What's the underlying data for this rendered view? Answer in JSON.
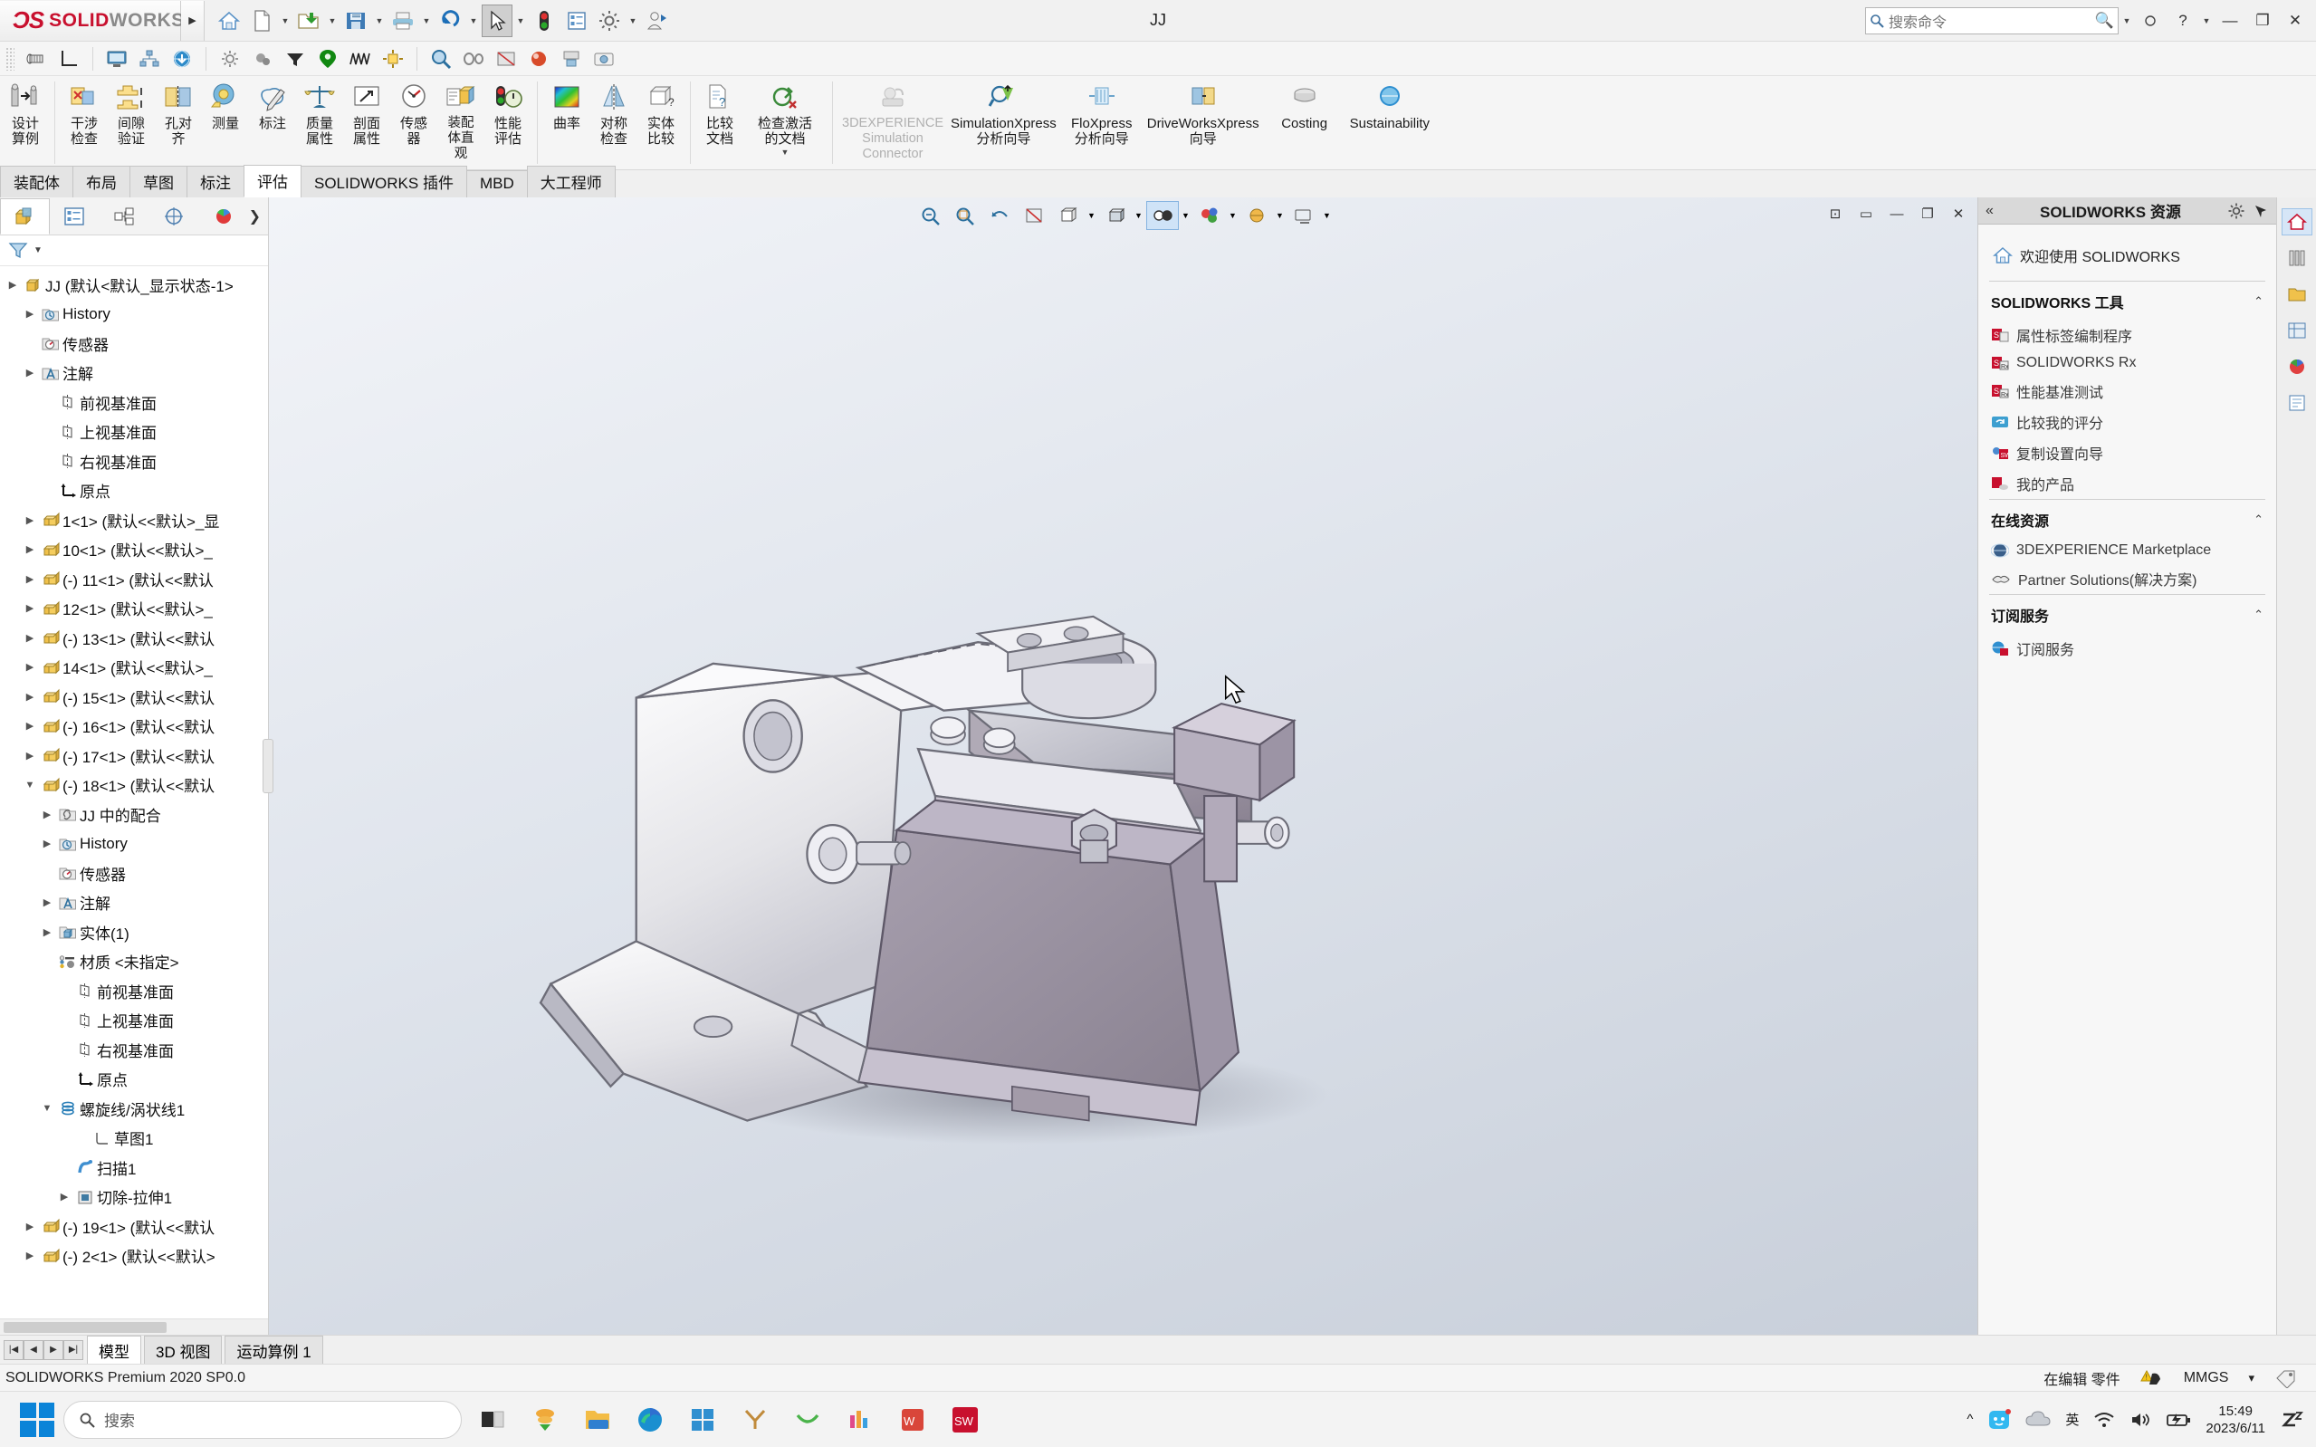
{
  "app": {
    "brand_sol": "SOLID",
    "brand_works": "WORKS",
    "document_title": "JJ",
    "status_version": "SOLIDWORKS Premium 2020 SP0.0"
  },
  "titlebar": {
    "search_placeholder": "搜索命令",
    "buttons": [
      {
        "name": "home-button",
        "icon": "home-icon"
      },
      {
        "name": "new-document-button",
        "icon": "new-file-icon"
      },
      {
        "name": "open-document-button",
        "icon": "open-folder-icon"
      },
      {
        "name": "save-button",
        "icon": "save-disk-icon"
      },
      {
        "name": "print-button",
        "icon": "printer-icon"
      },
      {
        "name": "undo-button",
        "icon": "undo-arrow-icon"
      },
      {
        "name": "select-button",
        "icon": "cursor-arrow-icon"
      },
      {
        "name": "rebuild-button",
        "icon": "traffic-light-icon"
      },
      {
        "name": "file-properties-button",
        "icon": "properties-list-icon"
      },
      {
        "name": "options-button",
        "icon": "gear-icon"
      },
      {
        "name": "user-login-button",
        "icon": "user-icon"
      }
    ],
    "window_controls": [
      "?",
      "-",
      "□",
      "✕"
    ]
  },
  "quickbar": {
    "items": [
      {
        "name": "toggle-screw-icon",
        "icon": "bolt-icon"
      },
      {
        "name": "coordinate-icon",
        "icon": "axis-icon"
      },
      {
        "name": "display-icon",
        "icon": "monitor-icon"
      },
      {
        "name": "network-icon",
        "icon": "network-icon"
      },
      {
        "name": "globe-download-icon",
        "icon": "globe-icon"
      },
      {
        "name": "gear-small-icon",
        "icon": "gear-icon"
      },
      {
        "name": "gears-icon",
        "icon": "gears-icon"
      },
      {
        "name": "funnel-icon",
        "icon": "funnel-icon"
      },
      {
        "name": "location-pin-icon",
        "icon": "pin-icon"
      },
      {
        "name": "spring-icon",
        "icon": "spring-icon"
      },
      {
        "name": "move-component-icon",
        "icon": "move-icon"
      },
      {
        "name": "zoom-icon",
        "icon": "magnifier-icon"
      },
      {
        "name": "belt-icon",
        "icon": "belt-icon"
      },
      {
        "name": "section-icon",
        "icon": "section-icon"
      },
      {
        "name": "appearance-icon",
        "icon": "appearance-icon"
      },
      {
        "name": "print3d-icon",
        "icon": "print3d-icon"
      },
      {
        "name": "capture-icon",
        "icon": "capture-icon"
      }
    ]
  },
  "ribbon": {
    "groups": [
      {
        "items": [
          {
            "name": "design-study",
            "label_lines": [
              "设计",
              "算例"
            ],
            "icon": "design-study-icon",
            "disabled": false
          }
        ]
      },
      {
        "items": [
          {
            "name": "interference-detection",
            "label_lines": [
              "干涉",
              "检查"
            ],
            "icon": "interference-icon"
          },
          {
            "name": "clearance-verification",
            "label_lines": [
              "间隙",
              "验证"
            ],
            "icon": "clearance-icon"
          },
          {
            "name": "hole-alignment",
            "label_lines": [
              "孔对",
              "齐"
            ],
            "icon": "hole-align-icon"
          },
          {
            "name": "measure",
            "label_lines": [
              "测量"
            ],
            "icon": "measure-tape-icon"
          },
          {
            "name": "markup",
            "label_lines": [
              "标注"
            ],
            "icon": "markup-pen-icon"
          },
          {
            "name": "mass-properties",
            "label_lines": [
              "质量",
              "属性"
            ],
            "icon": "scale-icon"
          },
          {
            "name": "section-properties",
            "label_lines": [
              "剖面",
              "属性"
            ],
            "icon": "section-prop-icon"
          },
          {
            "name": "sensor",
            "label_lines": [
              "传感",
              "器"
            ],
            "icon": "sensor-gauge-icon"
          },
          {
            "name": "assembly-visualization",
            "label_lines": [
              "装配",
              "体直",
              "观"
            ],
            "icon": "assembly-vis-icon"
          },
          {
            "name": "performance-evaluation",
            "label_lines": [
              "性能",
              "评估"
            ],
            "icon": "performance-icon"
          }
        ]
      },
      {
        "items": [
          {
            "name": "curvature",
            "label_lines": [
              "曲率"
            ],
            "icon": "curvature-icon"
          },
          {
            "name": "symmetry-check",
            "label_lines": [
              "对称",
              "检查"
            ],
            "icon": "symmetry-icon"
          },
          {
            "name": "geometry-compare",
            "label_lines": [
              "实体",
              "比较"
            ],
            "icon": "solid-compare-icon"
          }
        ]
      },
      {
        "items": [
          {
            "name": "compare-documents",
            "label_lines": [
              "比较",
              "文档"
            ],
            "icon": "compare-doc-icon"
          },
          {
            "name": "check-active-document",
            "label_lines": [
              "检查激活",
              "的文档"
            ],
            "icon": "check-doc-icon",
            "has_caret": true
          }
        ]
      },
      {
        "items": [
          {
            "name": "3dexperience-simulation-connector",
            "label_lines": [
              "3DEXPERIENCE",
              "Simulation",
              "Connector"
            ],
            "icon": "3dx-sim-icon",
            "disabled": true
          },
          {
            "name": "simulationxpress-wizard",
            "label_lines": [
              "SimulationXpress",
              "分析向导"
            ],
            "icon": "simulationxpress-icon"
          },
          {
            "name": "floxpress-wizard",
            "label_lines": [
              "FloXpress",
              "分析向导"
            ],
            "icon": "floxpress-icon"
          },
          {
            "name": "driveworksxpress-wizard",
            "label_lines": [
              "DriveWorksXpress",
              "向导"
            ],
            "icon": "driveworksxpress-icon"
          },
          {
            "name": "costing",
            "label_lines": [
              "Costing"
            ],
            "icon": "costing-icon"
          },
          {
            "name": "sustainability",
            "label_lines": [
              "Sustainability"
            ],
            "icon": "sustainability-icon"
          }
        ]
      }
    ]
  },
  "command_tabs": {
    "items": [
      {
        "label": "装配体",
        "active": false
      },
      {
        "label": "布局",
        "active": false
      },
      {
        "label": "草图",
        "active": false
      },
      {
        "label": "标注",
        "active": false
      },
      {
        "label": "评估",
        "active": true
      },
      {
        "label": "SOLIDWORKS 插件",
        "active": false
      },
      {
        "label": "MBD",
        "active": false
      },
      {
        "label": "大工程师",
        "active": false
      }
    ]
  },
  "feature_manager": {
    "tabs": [
      {
        "name": "feature-tree-tab",
        "icon": "assembly-tree-icon",
        "selected": true
      },
      {
        "name": "property-manager-tab",
        "icon": "property-list-icon",
        "selected": false
      },
      {
        "name": "configuration-manager-tab",
        "icon": "config-icon",
        "selected": false
      },
      {
        "name": "dimxpert-manager-tab",
        "icon": "dimxpert-icon",
        "selected": false
      },
      {
        "name": "display-manager-tab",
        "icon": "display-palette-icon",
        "selected": false
      }
    ],
    "filter_placeholder": "",
    "tree": [
      {
        "label": "JJ (默认<默认_显示状态-1>",
        "indent": 0,
        "icon": "assembly-icon",
        "twisty": "collapsed"
      },
      {
        "label": "History",
        "indent": 1,
        "icon": "history-folder-icon",
        "twisty": "collapsed"
      },
      {
        "label": "传感器",
        "indent": 1,
        "icon": "sensor-folder-icon",
        "twisty": "none"
      },
      {
        "label": "注解",
        "indent": 1,
        "icon": "annotation-folder-icon",
        "twisty": "collapsed"
      },
      {
        "label": "前视基准面",
        "indent": 2,
        "icon": "plane-icon",
        "twisty": "none"
      },
      {
        "label": "上视基准面",
        "indent": 2,
        "icon": "plane-icon",
        "twisty": "none"
      },
      {
        "label": "右视基准面",
        "indent": 2,
        "icon": "plane-icon",
        "twisty": "none"
      },
      {
        "label": "原点",
        "indent": 2,
        "icon": "origin-icon",
        "twisty": "none"
      },
      {
        "label": "1<1> (默认<<默认>_显",
        "indent": 1,
        "icon": "part-icon",
        "twisty": "collapsed"
      },
      {
        "label": "10<1> (默认<<默认>_",
        "indent": 1,
        "icon": "part-icon",
        "twisty": "collapsed"
      },
      {
        "label": "(-) 11<1> (默认<<默认",
        "indent": 1,
        "icon": "part-icon",
        "twisty": "collapsed"
      },
      {
        "label": "12<1> (默认<<默认>_",
        "indent": 1,
        "icon": "part-icon",
        "twisty": "collapsed"
      },
      {
        "label": "(-) 13<1> (默认<<默认",
        "indent": 1,
        "icon": "part-icon",
        "twisty": "collapsed"
      },
      {
        "label": "14<1> (默认<<默认>_",
        "indent": 1,
        "icon": "part-icon",
        "twisty": "collapsed"
      },
      {
        "label": "(-) 15<1> (默认<<默认",
        "indent": 1,
        "icon": "part-icon",
        "twisty": "collapsed"
      },
      {
        "label": "(-) 16<1> (默认<<默认",
        "indent": 1,
        "icon": "part-icon",
        "twisty": "collapsed"
      },
      {
        "label": "(-) 17<1> (默认<<默认",
        "indent": 1,
        "icon": "part-icon",
        "twisty": "collapsed"
      },
      {
        "label": "(-) 18<1> (默认<<默认",
        "indent": 1,
        "icon": "part-icon",
        "twisty": "expanded"
      },
      {
        "label": "JJ 中的配合",
        "indent": 2,
        "icon": "mates-folder-icon",
        "twisty": "collapsed"
      },
      {
        "label": "History",
        "indent": 2,
        "icon": "history-folder-icon",
        "twisty": "collapsed"
      },
      {
        "label": "传感器",
        "indent": 2,
        "icon": "sensor-folder-icon",
        "twisty": "none"
      },
      {
        "label": "注解",
        "indent": 2,
        "icon": "annotation-folder-icon",
        "twisty": "collapsed"
      },
      {
        "label": "实体(1)",
        "indent": 2,
        "icon": "solid-bodies-icon",
        "twisty": "collapsed"
      },
      {
        "label": "材质 <未指定>",
        "indent": 2,
        "icon": "material-icon",
        "twisty": "none"
      },
      {
        "label": "前视基准面",
        "indent": 3,
        "icon": "plane-icon",
        "twisty": "none"
      },
      {
        "label": "上视基准面",
        "indent": 3,
        "icon": "plane-icon",
        "twisty": "none"
      },
      {
        "label": "右视基准面",
        "indent": 3,
        "icon": "plane-icon",
        "twisty": "none"
      },
      {
        "label": "原点",
        "indent": 3,
        "icon": "origin-icon",
        "twisty": "none"
      },
      {
        "label": "螺旋线/涡状线1",
        "indent": 2,
        "icon": "helix-icon",
        "twisty": "expanded"
      },
      {
        "label": "草图1",
        "indent": 4,
        "icon": "sketch-icon",
        "twisty": "none"
      },
      {
        "label": "扫描1",
        "indent": 3,
        "icon": "sweep-icon",
        "twisty": "none"
      },
      {
        "label": "切除-拉伸1",
        "indent": 3,
        "icon": "extrude-cut-icon",
        "twisty": "collapsed"
      },
      {
        "label": "(-) 19<1> (默认<<默认",
        "indent": 1,
        "icon": "part-icon",
        "twisty": "collapsed"
      },
      {
        "label": "(-) 2<1> (默认<<默认>",
        "indent": 1,
        "icon": "part-icon",
        "twisty": "collapsed"
      }
    ]
  },
  "graphics_toolbar": {
    "items": [
      {
        "name": "zoom-to-fit-button",
        "icon": "zoom-fit-icon"
      },
      {
        "name": "zoom-to-area-button",
        "icon": "zoom-area-icon"
      },
      {
        "name": "previous-view-button",
        "icon": "previous-view-icon"
      },
      {
        "name": "section-view-button",
        "icon": "section-view-icon"
      },
      {
        "name": "view-orientation-button",
        "icon": "view-orientation-icon"
      },
      {
        "name": "display-style-button",
        "icon": "display-style-icon"
      },
      {
        "name": "hide-show-items-button",
        "icon": "eyeglasses-icon"
      },
      {
        "name": "edit-appearance-button",
        "icon": "sphere-appearance-icon"
      },
      {
        "name": "apply-scene-button",
        "icon": "scene-icon"
      },
      {
        "name": "view-settings-button",
        "icon": "view-settings-icon"
      }
    ]
  },
  "graphics_window_controls": [
    "⊡",
    "▭",
    "—",
    "❐",
    "✕"
  ],
  "task_pane": {
    "title": "SOLIDWORKS 资源",
    "welcome": "欢迎使用 SOLIDWORKS",
    "sections": [
      {
        "heading": "SOLIDWORKS 工具",
        "links": [
          {
            "label": "属性标签编制程序",
            "icon": "sw-tool-icon"
          },
          {
            "label": "SOLIDWORKS Rx",
            "icon": "sw-rx-icon"
          },
          {
            "label": "性能基准测试",
            "icon": "sw-benchmark-icon"
          },
          {
            "label": "比较我的评分",
            "icon": "compare-score-icon"
          },
          {
            "label": "复制设置向导",
            "icon": "copy-settings-icon"
          },
          {
            "label": "我的产品",
            "icon": "my-products-icon"
          }
        ]
      },
      {
        "heading": "在线资源",
        "links": [
          {
            "label": "3DEXPERIENCE Marketplace",
            "icon": "marketplace-icon"
          },
          {
            "label": "Partner Solutions(解决方案)",
            "icon": "partner-icon"
          }
        ]
      },
      {
        "heading": "订阅服务",
        "links": [
          {
            "label": "订阅服务",
            "icon": "subscription-icon"
          }
        ]
      }
    ]
  },
  "right_rail": {
    "items": [
      {
        "name": "rail-home-icon",
        "selected": true
      },
      {
        "name": "rail-library-icon",
        "selected": false
      },
      {
        "name": "rail-file-explorer-icon",
        "selected": false
      },
      {
        "name": "rail-view-palette-icon",
        "selected": false
      },
      {
        "name": "rail-appearances-icon",
        "selected": false
      },
      {
        "name": "rail-custom-properties-icon",
        "selected": false
      }
    ]
  },
  "bottom_tabs": {
    "nav": [
      "|◀",
      "◀",
      "▶",
      "▶|"
    ],
    "items": [
      {
        "label": "模型",
        "active": true
      },
      {
        "label": "3D 视图",
        "active": false
      },
      {
        "label": "运动算例 1",
        "active": false
      }
    ]
  },
  "statusbar": {
    "left": "SOLIDWORKS Premium 2020 SP0.0",
    "editing": "在编辑 零件",
    "units": "MMGS",
    "units_caret": "▾"
  },
  "taskbar": {
    "search_placeholder": "搜索",
    "apps": [
      {
        "name": "taskview-button",
        "icon": "task-view-icon"
      },
      {
        "name": "widget-button",
        "icon": "widgets-icon"
      },
      {
        "name": "file-explorer-button",
        "icon": "folder-icon"
      },
      {
        "name": "edge-button",
        "icon": "edge-icon"
      },
      {
        "name": "store-button",
        "icon": "store-icon"
      },
      {
        "name": "app6-button",
        "icon": "app-y-icon"
      },
      {
        "name": "app7-button",
        "icon": "app-green-icon"
      },
      {
        "name": "app8-button",
        "icon": "app-colorful-icon"
      },
      {
        "name": "wps-button",
        "icon": "wps-icon"
      },
      {
        "name": "solidworks-button",
        "icon": "solidworks-taskbar-icon"
      }
    ],
    "tray": {
      "overflow": "^",
      "ime": "英",
      "clock_time": "15:49",
      "clock_date": "2023/6/11"
    }
  }
}
